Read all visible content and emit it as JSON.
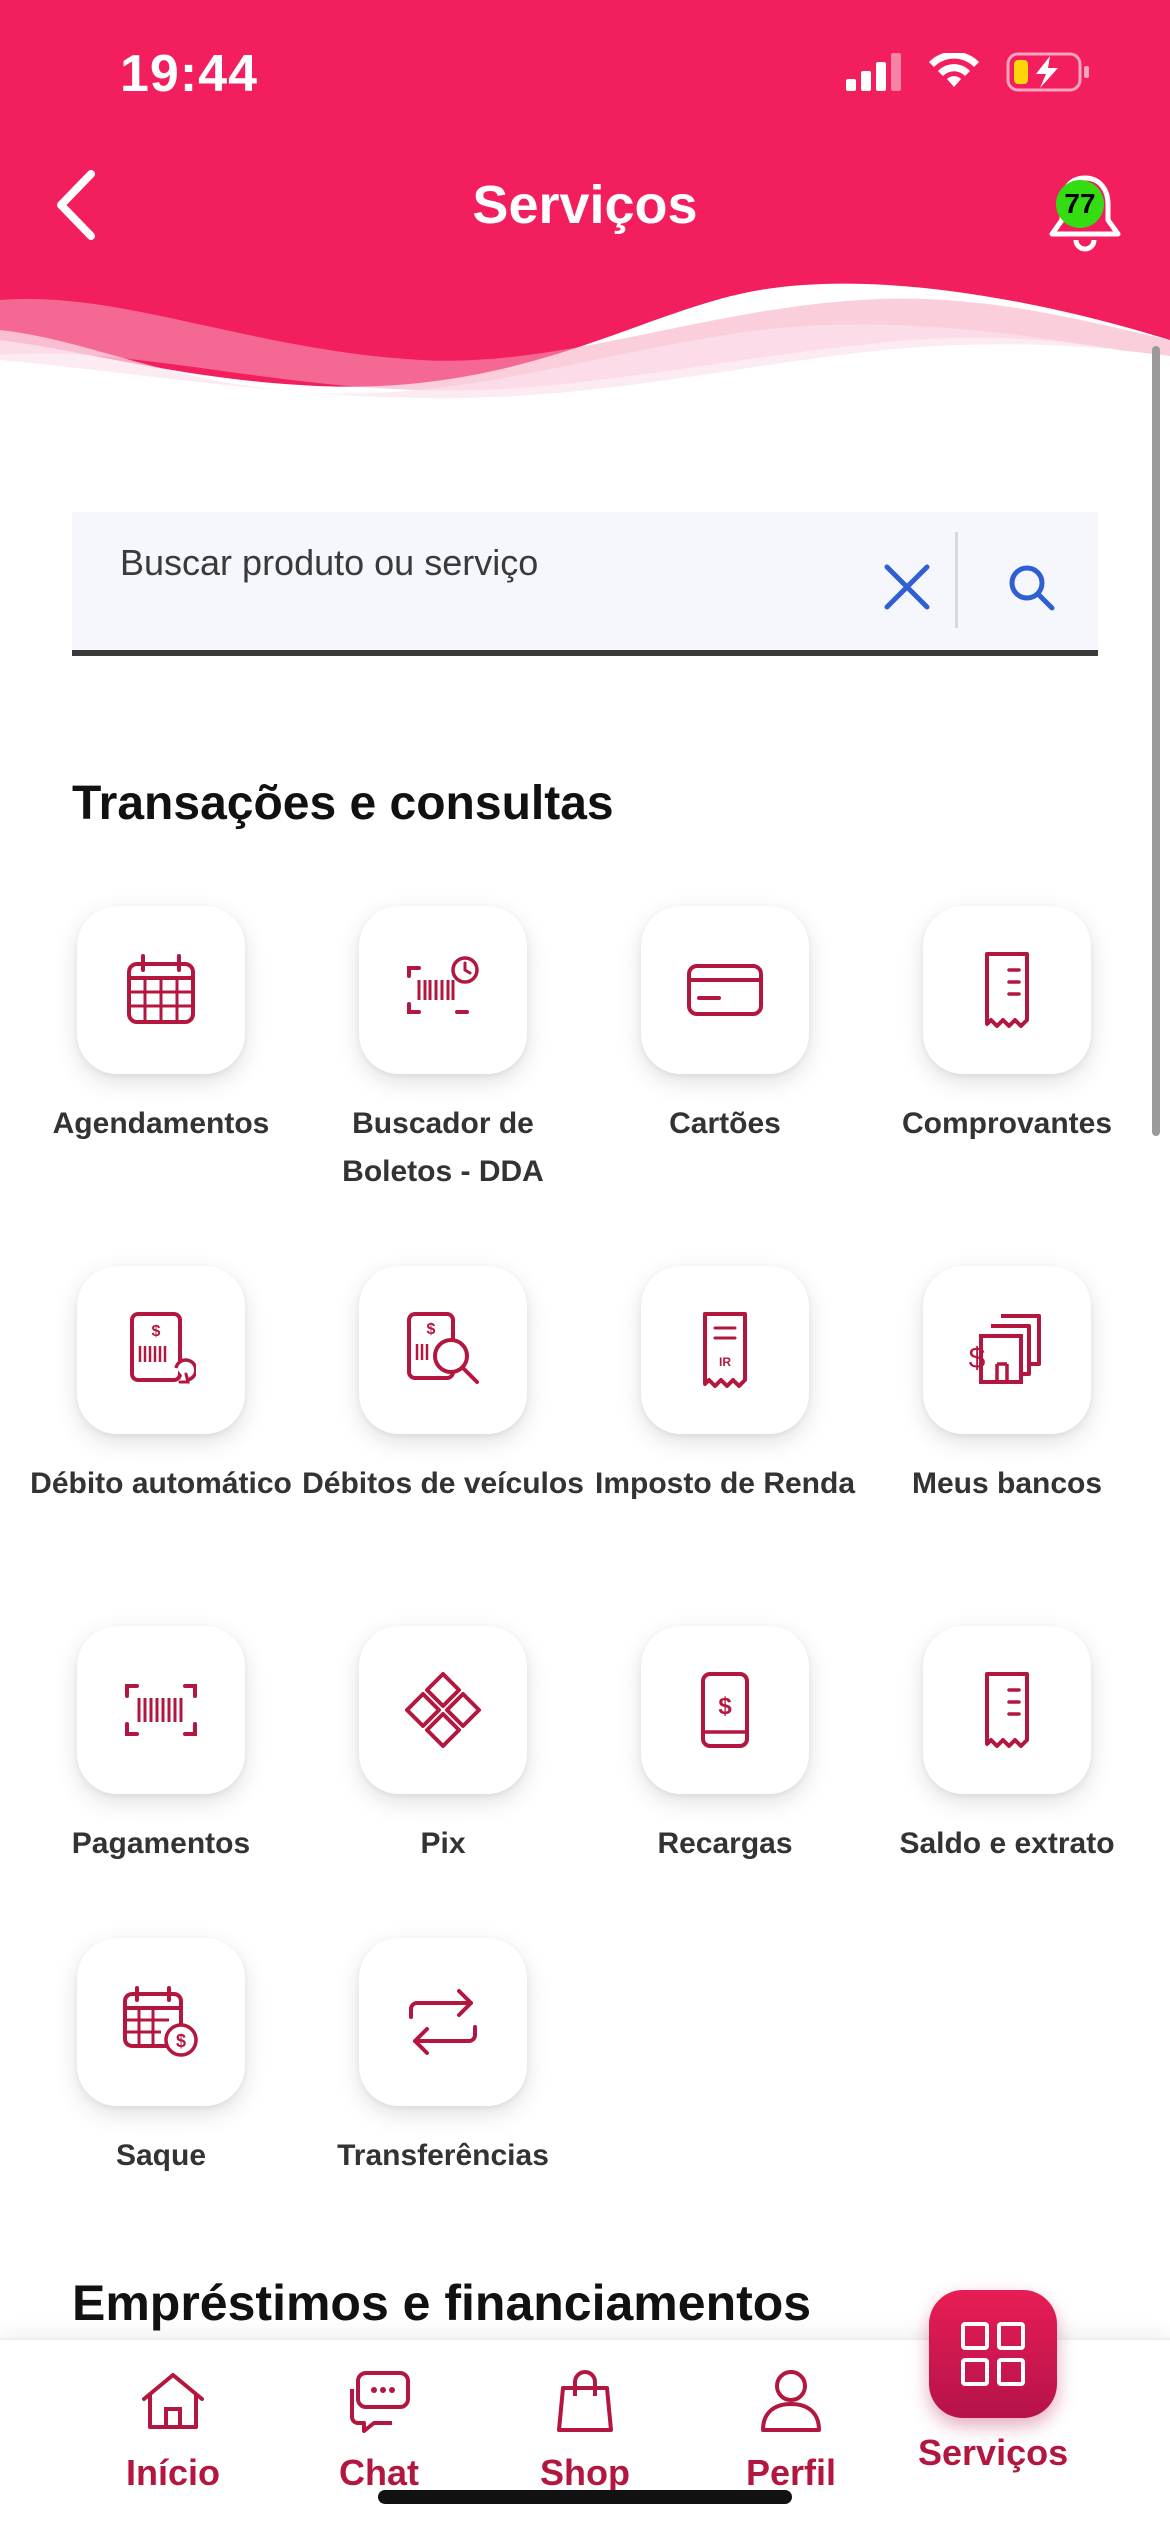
{
  "status_bar": {
    "time": "19:44"
  },
  "header": {
    "title": "Serviços",
    "notification_count": "77"
  },
  "search": {
    "placeholder": "Buscar produto ou serviço"
  },
  "sections": [
    {
      "title": "Transações e consultas"
    },
    {
      "title": "Empréstimos e financiamentos"
    }
  ],
  "tiles": [
    {
      "label": "Agendamentos",
      "icon": "calendar-icon"
    },
    {
      "label": "Buscador de Boletos - DDA",
      "icon": "barcode-clock-icon"
    },
    {
      "label": "Cartões",
      "icon": "card-icon"
    },
    {
      "label": "Comprovantes",
      "icon": "receipt-icon"
    },
    {
      "label": "Débito automático",
      "icon": "auto-debit-icon"
    },
    {
      "label": "Débitos de veículos",
      "icon": "vehicle-debit-search-icon"
    },
    {
      "label": "Imposto de Renda",
      "icon": "tax-receipt-icon"
    },
    {
      "label": "Meus bancos",
      "icon": "banks-icon"
    },
    {
      "label": "Pagamentos",
      "icon": "barcode-icon"
    },
    {
      "label": "Pix",
      "icon": "pix-icon"
    },
    {
      "label": "Recargas",
      "icon": "phone-recharge-icon"
    },
    {
      "label": "Saldo e extrato",
      "icon": "statement-icon"
    },
    {
      "label": "Saque",
      "icon": "withdraw-calendar-icon"
    },
    {
      "label": "Transferências",
      "icon": "transfer-arrows-icon"
    }
  ],
  "bottom_nav": {
    "items": [
      {
        "label": "Início",
        "icon": "home-icon"
      },
      {
        "label": "Chat",
        "icon": "chat-icon"
      },
      {
        "label": "Shop",
        "icon": "shopping-bag-icon"
      },
      {
        "label": "Perfil",
        "icon": "person-icon"
      },
      {
        "label": "Serviços",
        "icon": "grid-icon"
      }
    ]
  },
  "colors": {
    "brand": "#f21e5e",
    "accent": "#b3173f",
    "badge": "#33dd11",
    "link_blue": "#2f5fd0"
  }
}
